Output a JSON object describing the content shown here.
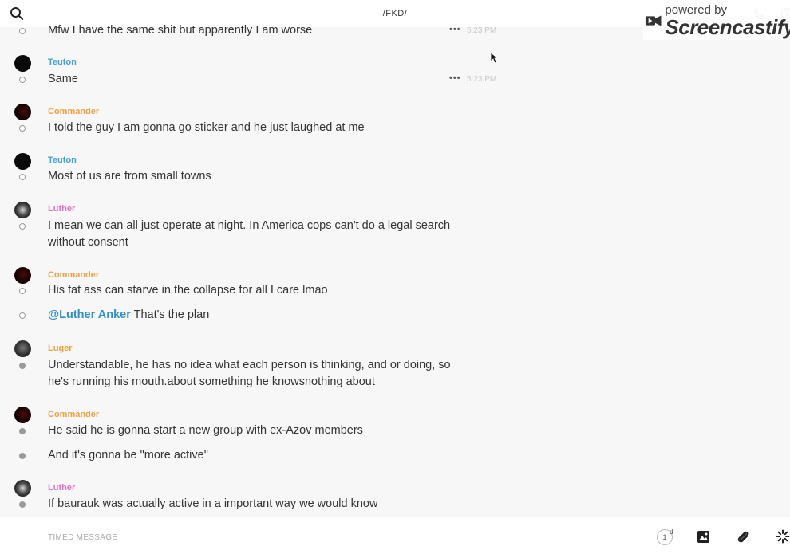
{
  "header": {
    "title": "/FKD/",
    "icons": [
      "search-icon",
      "phone-icon",
      "info-icon"
    ]
  },
  "watermark": {
    "powered": "powered by",
    "brand": "Screencastify"
  },
  "colors": {
    "teuton": "#3fa3d8",
    "commander": "#f0a040",
    "luther": "#e070c8",
    "luger": "#f0a040",
    "mention": "#2f8fd0"
  },
  "messages": [
    {
      "text": "Mfw I have the same shit but apparently I am worse",
      "time": "5:23 PM"
    },
    {
      "sender": "Teuton",
      "text": "Same",
      "time": "5:23 PM"
    },
    {
      "sender": "Commander",
      "text": "I told the guy I am gonna go sticker and he just laughed at me"
    },
    {
      "sender": "Teuton",
      "text": "Most of us are from small towns"
    },
    {
      "sender": "Luther",
      "text": "I mean we can all just operate at night. In America cops can't do a legal search without consent"
    },
    {
      "sender": "Commander",
      "text": "His fat ass can starve in the collapse for all I care lmao"
    },
    {
      "mention": "@Luther Anker",
      "text": " That's the plan"
    },
    {
      "sender": "Luger",
      "text": "Understandable, he has no idea what each person is thinking, and or doing, so he's running his mouth.about something he knowsnothing about"
    },
    {
      "sender": "Commander",
      "text": "He said he is gonna start a new group with ex-Azov members"
    },
    {
      "text": "And it's gonna be \"more active\""
    },
    {
      "sender": "Luther",
      "text": "If baurauk was actually active in a important way we would know"
    }
  ],
  "composer": {
    "placeholder": "TIMED MESSAGE",
    "timer_value": "1",
    "timer_unit": "d"
  }
}
